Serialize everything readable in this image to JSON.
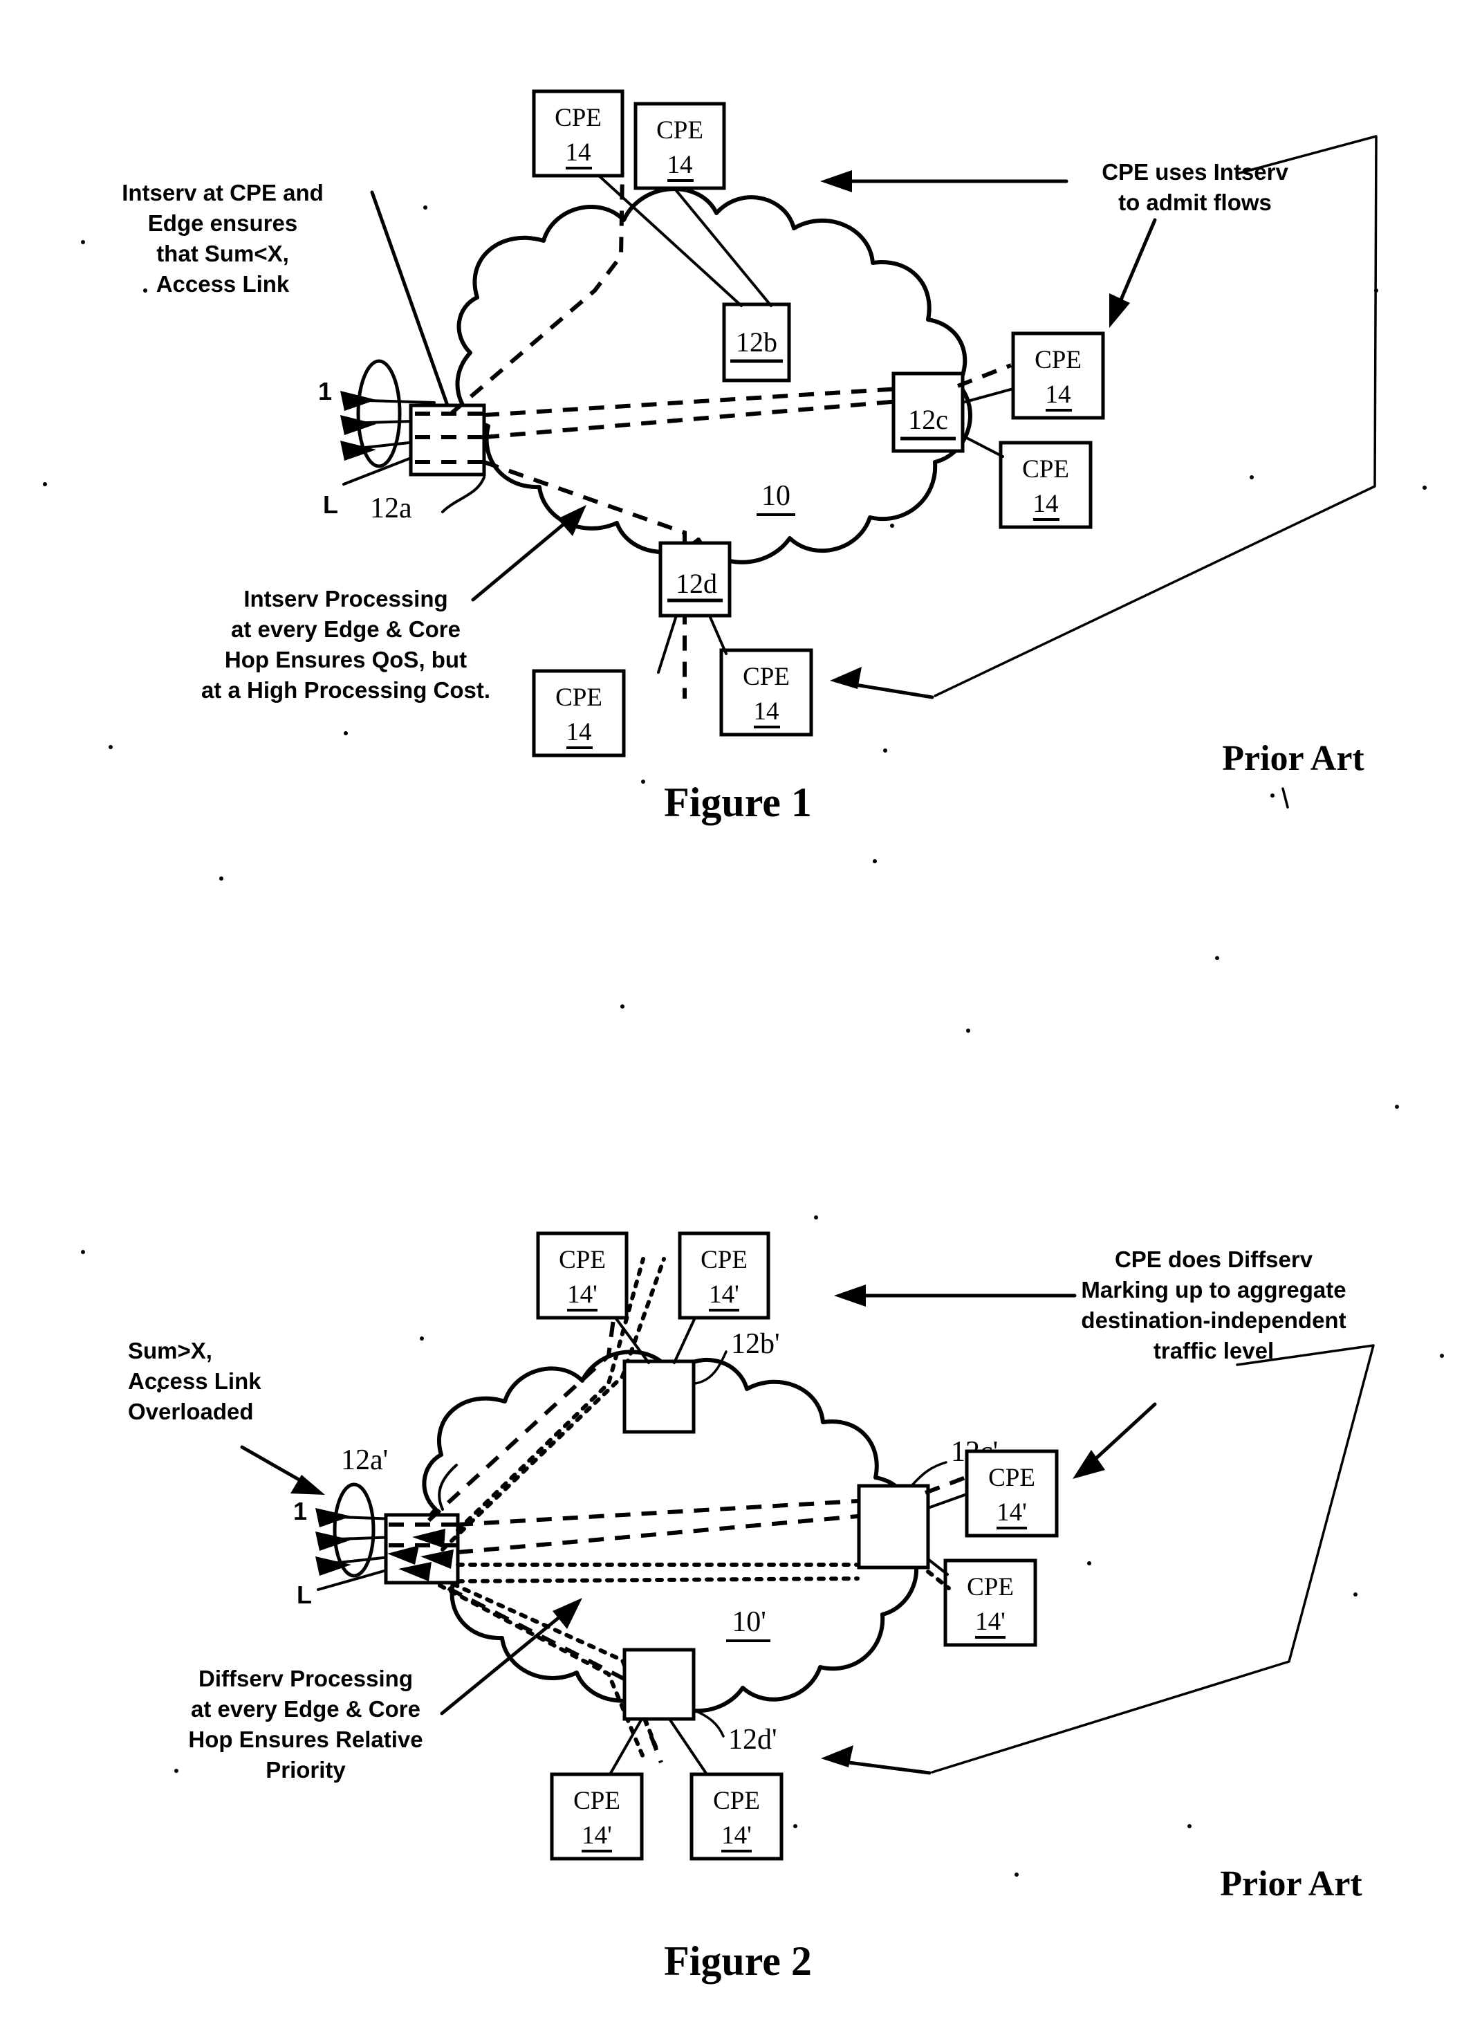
{
  "document": {
    "type": "patent-drawing-sheet",
    "figures": [
      {
        "id": "figure-1",
        "caption": "Figure 1",
        "prior_art_label": "Prior Art",
        "cloud_label": "10",
        "annotations": [
          {
            "id": "annot-intserv-cpe-edge",
            "lines": [
              "Intserv at CPE and",
              "Edge ensures",
              "that Sum<X,",
              "Access Link"
            ]
          },
          {
            "id": "annot-cpe-uses-intserv",
            "lines": [
              "CPE uses  Intserv",
              "to admit flows"
            ]
          },
          {
            "id": "annot-intserv-processing",
            "lines": [
              "Intserv Processing",
              "at every Edge & Core",
              "Hop Ensures QoS, but",
              "at a High Processing Cost."
            ]
          }
        ],
        "access_link_labels": {
          "top": "1",
          "bottom": "L"
        },
        "nodes": [
          {
            "id": "node-12a",
            "label": "12a",
            "label_position": "outside"
          },
          {
            "id": "node-12b",
            "label": "12b",
            "label_position": "inside"
          },
          {
            "id": "node-12c",
            "label": "12c",
            "label_position": "inside"
          },
          {
            "id": "node-12d",
            "label": "12d",
            "label_position": "inside"
          }
        ],
        "cpe_boxes": [
          {
            "id": "cpe-1",
            "title": "CPE",
            "ref": "14"
          },
          {
            "id": "cpe-2",
            "title": "CPE",
            "ref": "14"
          },
          {
            "id": "cpe-3",
            "title": "CPE",
            "ref": "14"
          },
          {
            "id": "cpe-4",
            "title": "CPE",
            "ref": "14"
          },
          {
            "id": "cpe-5",
            "title": "CPE",
            "ref": "14"
          },
          {
            "id": "cpe-6",
            "title": "CPE",
            "ref": "14"
          }
        ]
      },
      {
        "id": "figure-2",
        "caption": "Figure 2",
        "prior_art_label": "Prior Art",
        "cloud_label": "10'",
        "annotations": [
          {
            "id": "annot-sum-overloaded",
            "lines": [
              "Sum>X,",
              "Access Link",
              "Overloaded"
            ]
          },
          {
            "id": "annot-cpe-diffserv",
            "lines": [
              "CPE does Diffserv",
              "Marking up to aggregate",
              "destination-independent",
              "traffic level"
            ]
          },
          {
            "id": "annot-diffserv-processing",
            "lines": [
              "Diffserv Processing",
              "at every Edge & Core",
              "Hop Ensures Relative",
              "Priority"
            ]
          }
        ],
        "access_link_labels": {
          "top": "1",
          "bottom": "L"
        },
        "nodes": [
          {
            "id": "node-12a-prime",
            "label": "12a'",
            "label_position": "outside"
          },
          {
            "id": "node-12b-prime",
            "label": "12b'",
            "label_position": "outside"
          },
          {
            "id": "node-12c-prime",
            "label": "12c'",
            "label_position": "outside"
          },
          {
            "id": "node-12d-prime",
            "label": "12d'",
            "label_position": "outside"
          }
        ],
        "cpe_boxes": [
          {
            "id": "cpe-p1",
            "title": "CPE",
            "ref": "14'"
          },
          {
            "id": "cpe-p2",
            "title": "CPE",
            "ref": "14'"
          },
          {
            "id": "cpe-p3",
            "title": "CPE",
            "ref": "14'"
          },
          {
            "id": "cpe-p4",
            "title": "CPE",
            "ref": "14'"
          },
          {
            "id": "cpe-p5",
            "title": "CPE",
            "ref": "14'"
          },
          {
            "id": "cpe-p6",
            "title": "CPE",
            "ref": "14'"
          }
        ]
      }
    ],
    "colors": {
      "ink": "#000000",
      "paper": "#ffffff"
    }
  }
}
